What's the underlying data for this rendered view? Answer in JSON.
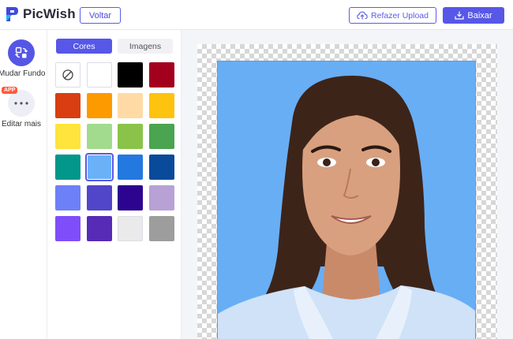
{
  "app": {
    "name": "PicWish",
    "brand_color": "#5757e8"
  },
  "header": {
    "back_label": "Voltar",
    "reupload_label": "Refazer Upload",
    "download_label": "Baixar"
  },
  "rail": {
    "tools": [
      {
        "label": "Mudar Fundo",
        "icon": "change-background-icon",
        "active": true
      },
      {
        "label": "Editar mais",
        "icon": "more-dots-icon",
        "badge": "APP",
        "active": false
      }
    ]
  },
  "panel": {
    "tabs": [
      {
        "label": "Cores",
        "active": true
      },
      {
        "label": "Imagens",
        "active": false
      }
    ],
    "colors": [
      [
        "none",
        "#ffffff",
        "#000000",
        "#a3001d"
      ],
      [
        "#d83e12",
        "#fd9a00",
        "#ffdaa4",
        "#fec30e"
      ],
      [
        "#fee43b",
        "#a2da8e",
        "#8bc34a",
        "#4aa450"
      ],
      [
        "#01978a",
        "#6bb1f7",
        "#2379e0",
        "#0a4a9a"
      ],
      [
        "#6e80f8",
        "#5146c9",
        "#2c048f",
        "#b8a1d5"
      ],
      [
        "#7f4efa",
        "#572bb5",
        "#eaeaea",
        "#9d9d9d"
      ]
    ],
    "selected_color": "#6bb1f7"
  },
  "canvas": {
    "background_color": "#68aef5"
  }
}
